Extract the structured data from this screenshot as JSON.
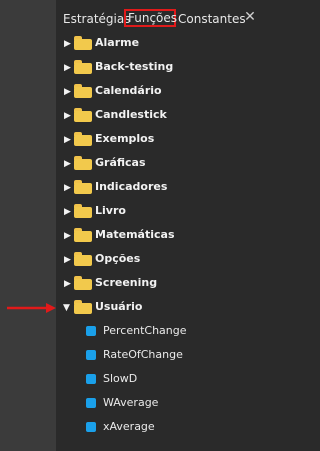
{
  "tabs": [
    {
      "label": "Estratégias"
    },
    {
      "label": "Funções"
    },
    {
      "label": "Constantes"
    }
  ],
  "close_symbol": "✕",
  "tree": {
    "folders": [
      {
        "label": "Alarme"
      },
      {
        "label": "Back-testing"
      },
      {
        "label": "Calendário"
      },
      {
        "label": "Candlestick"
      },
      {
        "label": "Exemplos"
      },
      {
        "label": "Gráficas"
      },
      {
        "label": "Indicadores"
      },
      {
        "label": "Livro"
      },
      {
        "label": "Matemáticas"
      },
      {
        "label": "Opções"
      },
      {
        "label": "Screening"
      },
      {
        "label": "Usuário"
      }
    ],
    "user_items": [
      {
        "label": "PercentChange"
      },
      {
        "label": "RateOfChange"
      },
      {
        "label": "SlowD"
      },
      {
        "label": "WAverage"
      },
      {
        "label": "xAverage"
      }
    ]
  },
  "colors": {
    "accent_highlight": "#e11a1a",
    "folder": "#f2c94c",
    "file_icon": "#1aa0ea",
    "arrow": "#e11a1a"
  },
  "icons": {
    "folder": "folder-icon",
    "file": "file-icon",
    "collapse": "caret-down-icon",
    "expand": "caret-right-icon",
    "close": "close-icon",
    "pointer": "red-arrow-icon"
  }
}
